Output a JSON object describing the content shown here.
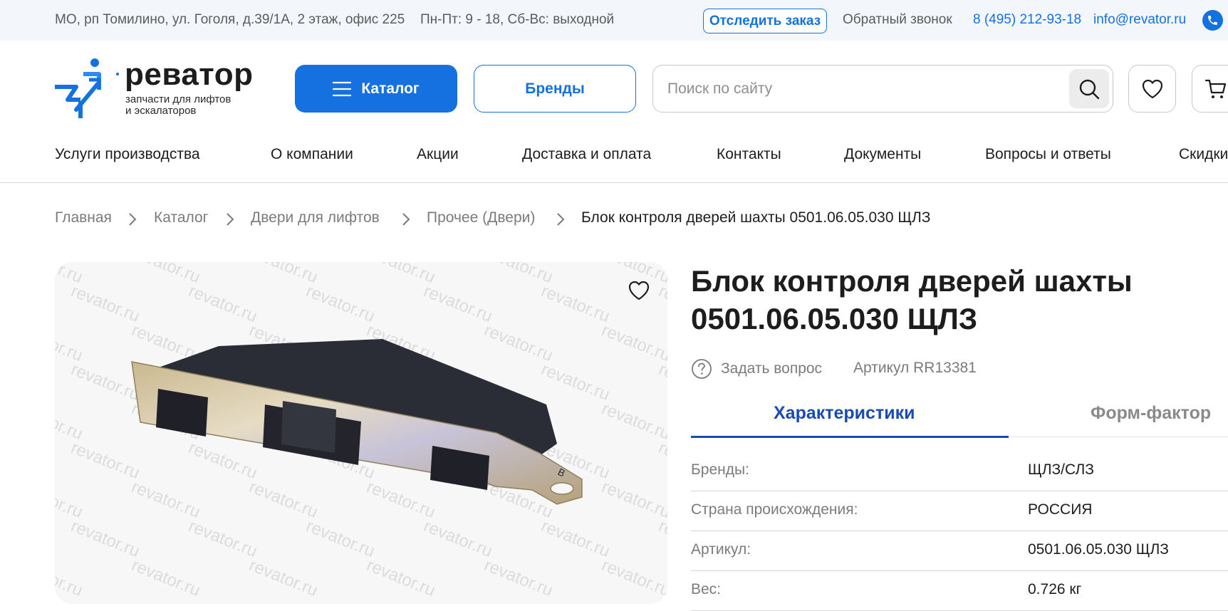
{
  "topbar": {
    "address": "МО, рп Томилино, ул. Гоголя, д.39/1А, 2 этаж, офис 225",
    "hours": "Пн-Пт: 9 - 18, Сб-Вс: выходной",
    "track_order": "Отследить заказ",
    "callback": "Обратный звонок",
    "phone": "8 (495) 212-93-18",
    "email": "info@revator.ru",
    "messenger_icon": "whatsapp-icon"
  },
  "header": {
    "logo_word": "реватор",
    "logo_sub_line1": "запчасти для лифтов",
    "logo_sub_line2": "и эскалаторов",
    "catalog_label": "Каталог",
    "brands_label": "Бренды",
    "search_placeholder": "Поиск по сайту",
    "search_icon": "search-icon",
    "favorites_icon": "heart-icon",
    "cart_icon": "cart-icon"
  },
  "nav": {
    "items": [
      "Услуги производства",
      "О компании",
      "Акции",
      "Доставка и оплата",
      "Контакты",
      "Документы",
      "Вопросы и ответы",
      "Скидки"
    ]
  },
  "breadcrumb": {
    "items": [
      "Главная",
      "Каталог",
      "Двери для лифтов",
      "Прочее (Двери)"
    ],
    "current": "Блок контроля дверей шахты 0501.06.05.030 ЩЛЗ"
  },
  "product": {
    "title_line1": "Блок контроля дверей шахты",
    "title_line2": "0501.06.05.030 ЩЛЗ",
    "ask_question": "Задать вопрос",
    "sku": "Артикул RR13381",
    "watermark": "revator.ru",
    "tabs": [
      "Характеристики",
      "Форм-фактор"
    ],
    "specs": [
      {
        "label": "Бренды:",
        "value": "ЩЛЗ/СЛЗ"
      },
      {
        "label": "Страна происхождения:",
        "value": "РОССИЯ"
      },
      {
        "label": "Артикул:",
        "value": "0501.06.05.030 ЩЛЗ"
      },
      {
        "label": "Вес:",
        "value": "0.726 кг"
      }
    ]
  },
  "colors": {
    "accent": "#1571e0",
    "tab_active": "#1a4bb2",
    "topbar_bg": "#f3f6fa",
    "muted_text": "#7b7b7b"
  }
}
